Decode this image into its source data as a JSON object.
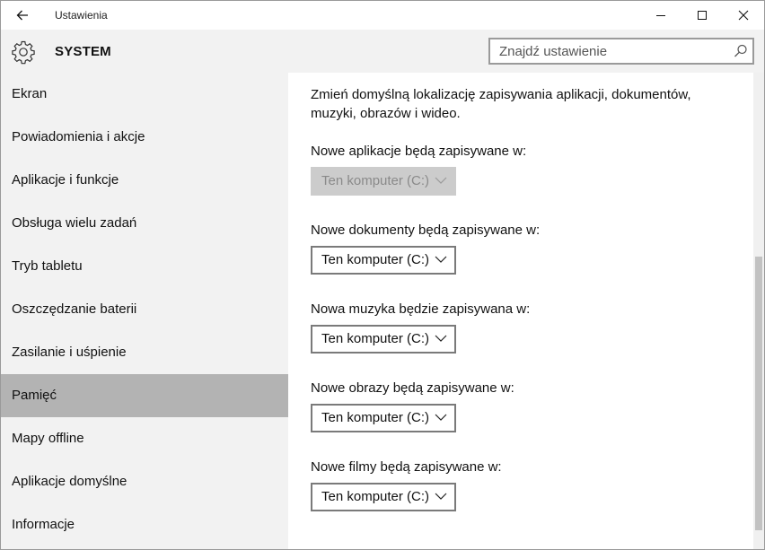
{
  "window": {
    "title": "Ustawienia"
  },
  "header": {
    "section_title": "SYSTEM",
    "search_placeholder": "Znajdź ustawienie"
  },
  "sidebar": {
    "items": [
      {
        "label": "Ekran",
        "selected": false
      },
      {
        "label": "Powiadomienia i akcje",
        "selected": false
      },
      {
        "label": "Aplikacje i funkcje",
        "selected": false
      },
      {
        "label": "Obsługa wielu zadań",
        "selected": false
      },
      {
        "label": "Tryb tabletu",
        "selected": false
      },
      {
        "label": "Oszczędzanie baterii",
        "selected": false
      },
      {
        "label": "Zasilanie i uśpienie",
        "selected": false
      },
      {
        "label": "Pamięć",
        "selected": true
      },
      {
        "label": "Mapy offline",
        "selected": false
      },
      {
        "label": "Aplikacje domyślne",
        "selected": false
      },
      {
        "label": "Informacje",
        "selected": false
      }
    ]
  },
  "main": {
    "intro": "Zmień domyślną lokalizację zapisywania aplikacji, dokumentów, muzyki, obrazów i wideo.",
    "settings": [
      {
        "label": "Nowe aplikacje będą zapisywane w:",
        "value": "Ten komputer (C:)",
        "disabled": true
      },
      {
        "label": "Nowe dokumenty będą zapisywane w:",
        "value": "Ten komputer (C:)",
        "disabled": false
      },
      {
        "label": "Nowa muzyka będzie zapisywana w:",
        "value": "Ten komputer (C:)",
        "disabled": false
      },
      {
        "label": "Nowe obrazy będą zapisywane w:",
        "value": "Ten komputer (C:)",
        "disabled": false
      },
      {
        "label": "Nowe filmy będą zapisywane w:",
        "value": "Ten komputer (C:)",
        "disabled": false
      }
    ]
  },
  "colors": {
    "sidebar_bg": "#f2f2f2",
    "selected_bg": "#b3b3b3",
    "disabled_dropdown_bg": "#cccccc"
  },
  "icons": [
    "back-arrow-icon",
    "minimize-icon",
    "maximize-icon",
    "close-icon",
    "gear-icon",
    "search-icon",
    "chevron-down-icon"
  ]
}
